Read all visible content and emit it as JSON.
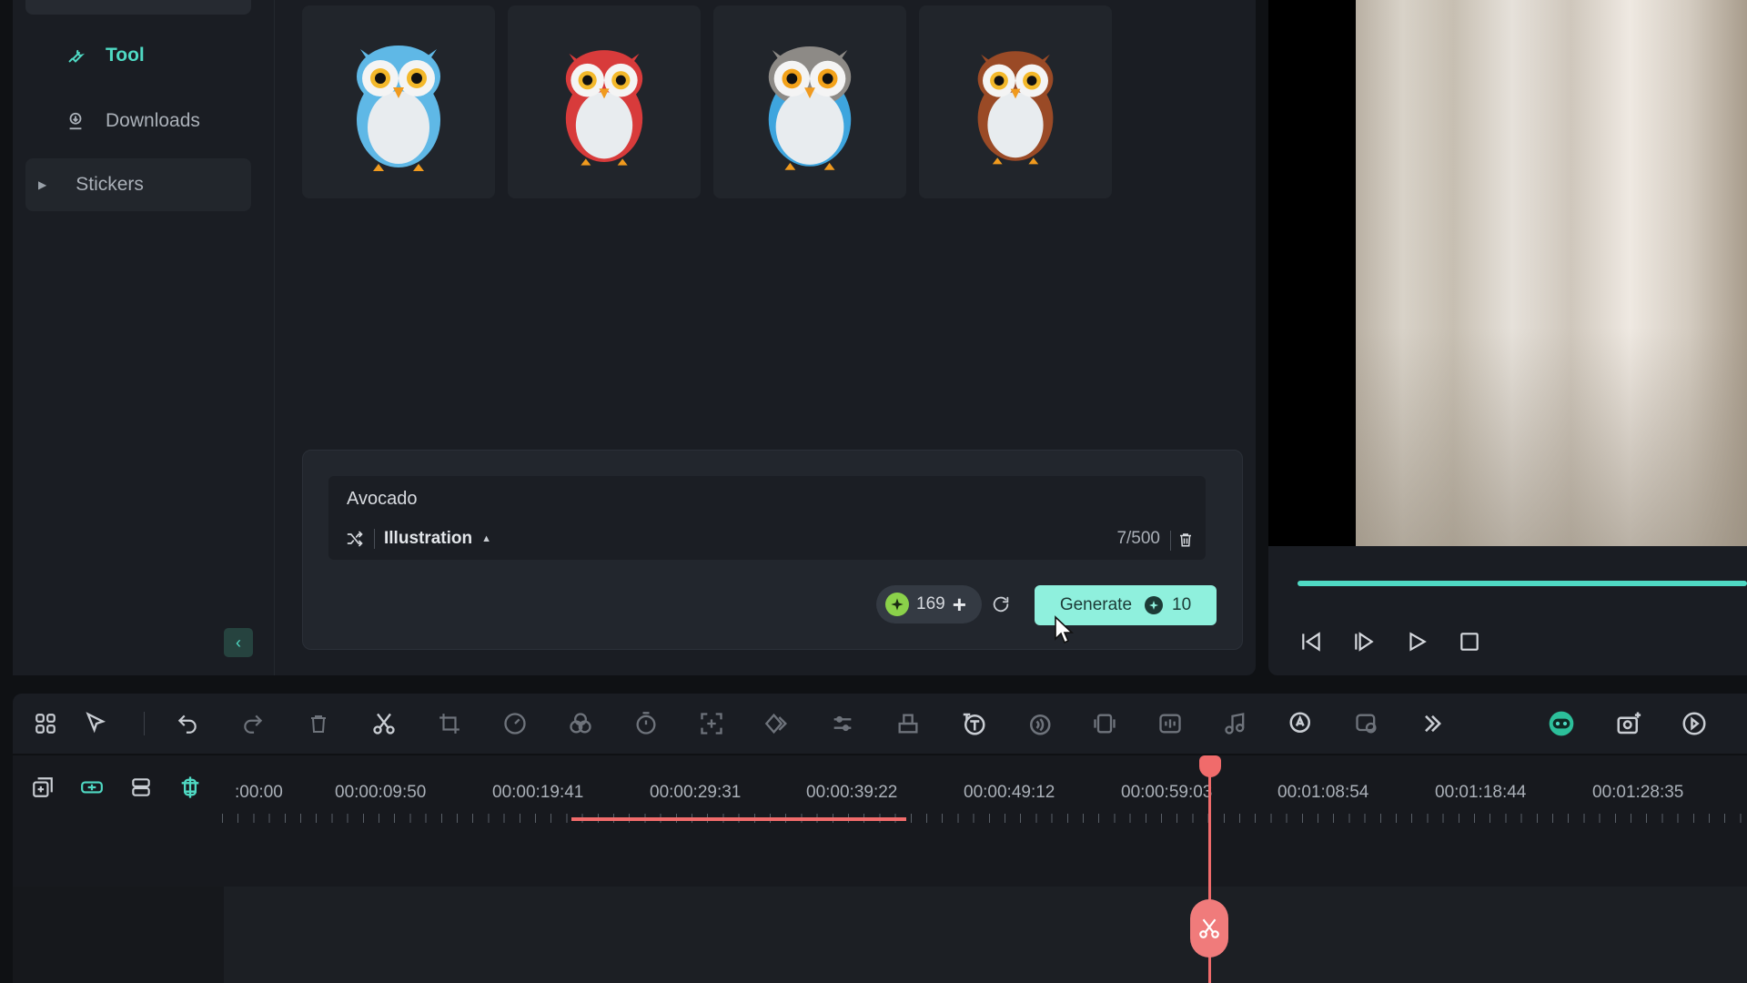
{
  "sidebar": {
    "items": [
      {
        "label": "Tool",
        "icon": "wrench-icon",
        "active": true
      },
      {
        "label": "Downloads",
        "icon": "download-icon",
        "active": false
      },
      {
        "label": "Stickers",
        "icon": "caret-right-icon",
        "active": false
      }
    ],
    "collapse_icon": "chevron-left-icon"
  },
  "stickers": [
    {
      "name": "owl-blue",
      "colors": {
        "body": "#5fb8e6",
        "belly": "#e8ecef"
      }
    },
    {
      "name": "owl-red",
      "colors": {
        "body": "#d83b3b",
        "belly": "#e8ecef"
      }
    },
    {
      "name": "owl-gray",
      "colors": {
        "body": "#8d8a86",
        "belly": "#e8ecef"
      }
    },
    {
      "name": "owl-brown",
      "colors": {
        "body": "#9a4a26",
        "belly": "#e8ecef"
      }
    }
  ],
  "prompt": {
    "text": "Avocado",
    "style": "Illustration",
    "char_count": "7/500"
  },
  "credits": {
    "value": "169"
  },
  "generate": {
    "label": "Generate",
    "cost": "10"
  },
  "player": {
    "progress": 1.0
  },
  "timeline": {
    "timecodes": [
      ":00:00",
      "00:00:09:50",
      "00:00:19:41",
      "00:00:29:31",
      "00:00:39:22",
      "00:00:49:12",
      "00:00:59:03",
      "00:01:08:54",
      "00:01:18:44",
      "00:01:28:35"
    ]
  },
  "colors": {
    "accent": "#4fd9c3",
    "playhead": "#f06b6b",
    "generate_bg": "#8ff0dd"
  }
}
